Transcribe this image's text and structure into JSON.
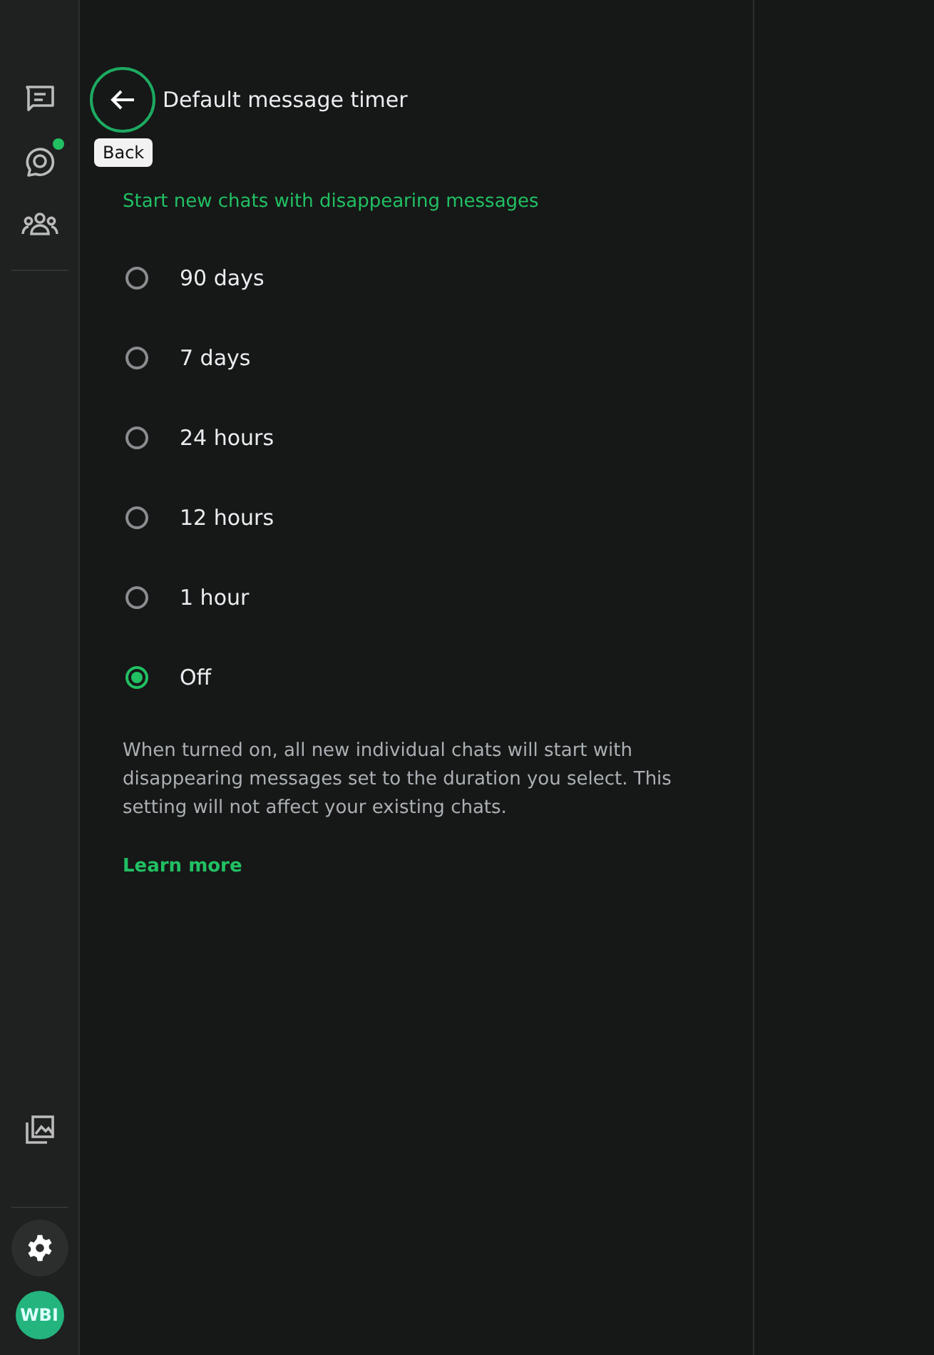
{
  "sidebar": {
    "top_items": [
      {
        "kind": "chats",
        "selected": false,
        "has_update": false
      },
      {
        "kind": "status",
        "selected": false,
        "has_update": true
      },
      {
        "kind": "communities",
        "selected": false,
        "has_update": false
      }
    ],
    "bottom_items": [
      {
        "kind": "media",
        "selected": false
      },
      {
        "kind": "settings",
        "selected": true
      }
    ],
    "avatar": {
      "initials": "WBI"
    }
  },
  "header": {
    "back_tooltip": "Back",
    "title": "Default message timer"
  },
  "subtitle": "Start new chats with disappearing messages",
  "options": [
    {
      "label": "90 days",
      "selected": false
    },
    {
      "label": "7 days",
      "selected": false
    },
    {
      "label": "24 hours",
      "selected": false
    },
    {
      "label": "12 hours",
      "selected": false
    },
    {
      "label": "1 hour",
      "selected": false
    },
    {
      "label": "Off",
      "selected": true
    }
  ],
  "description": "When turned on, all new individual chats will start with disappearing messages set to the duration you select. This setting will not affect your existing chats.",
  "learn_more": "Learn more"
}
